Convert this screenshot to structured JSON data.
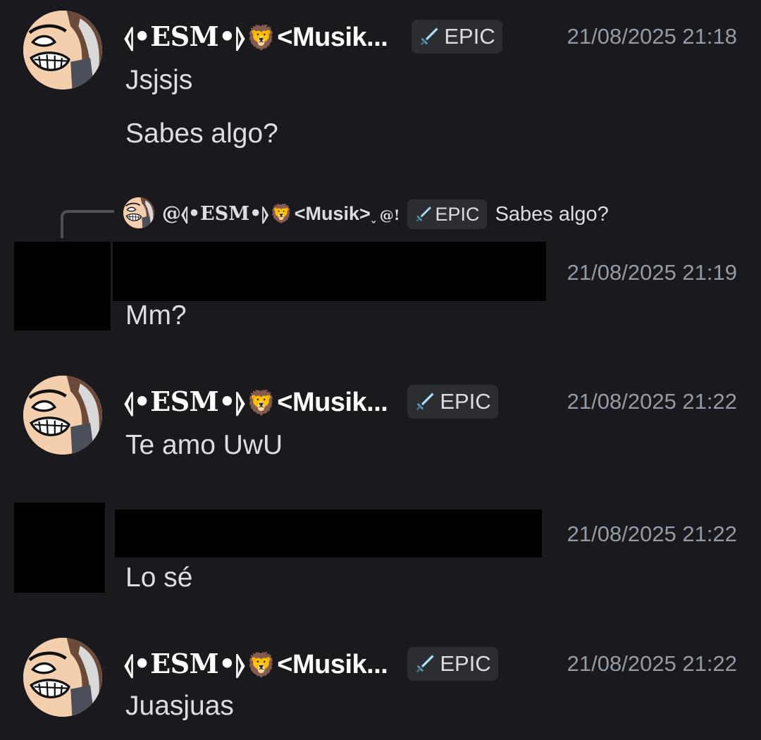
{
  "messages": [
    {
      "author": {
        "name_symbol": "⦉•ESM•⦊",
        "name_emoji": "🦁",
        "name_rest": "<Musik..."
      },
      "badge": {
        "icon": "sword-icon",
        "label": "EPIC"
      },
      "timestamp": "21/08/2025 21:18",
      "lines": [
        "Jsjsjs",
        "Sabes algo?"
      ]
    },
    {
      "reply_to": {
        "author": {
          "name_symbol": "@⦉•ESM•⦊",
          "name_emoji": "🦁",
          "name_rest": "<Musik>",
          "name_suffix": "˯",
          "name_icon": "@!"
        },
        "badge": {
          "icon": "sword-icon",
          "label": "EPIC"
        },
        "text": "Sabes algo?"
      },
      "author_redacted": true,
      "timestamp": "21/08/2025 21:19",
      "lines": [
        "Mm?"
      ]
    },
    {
      "author": {
        "name_symbol": "⦉•ESM•⦊",
        "name_emoji": "🦁",
        "name_rest": "<Musik..."
      },
      "badge": {
        "icon": "sword-icon",
        "label": "EPIC"
      },
      "timestamp": "21/08/2025 21:22",
      "lines": [
        "Te amo UwU"
      ]
    },
    {
      "author_redacted": true,
      "timestamp": "21/08/2025 21:22",
      "lines": [
        "Lo sé"
      ]
    },
    {
      "author": {
        "name_symbol": "⦉•ESM•⦊",
        "name_emoji": "🦁",
        "name_rest": "<Musik..."
      },
      "badge": {
        "icon": "sword-icon",
        "label": "EPIC"
      },
      "timestamp": "21/08/2025 21:22",
      "lines": [
        "Juasjuas"
      ]
    }
  ],
  "colors": {
    "background": "#1a1a1e",
    "text": "#dbdee1",
    "muted": "#949ba4",
    "badge_bg": "#2b2d31",
    "username": "#ffffff"
  }
}
